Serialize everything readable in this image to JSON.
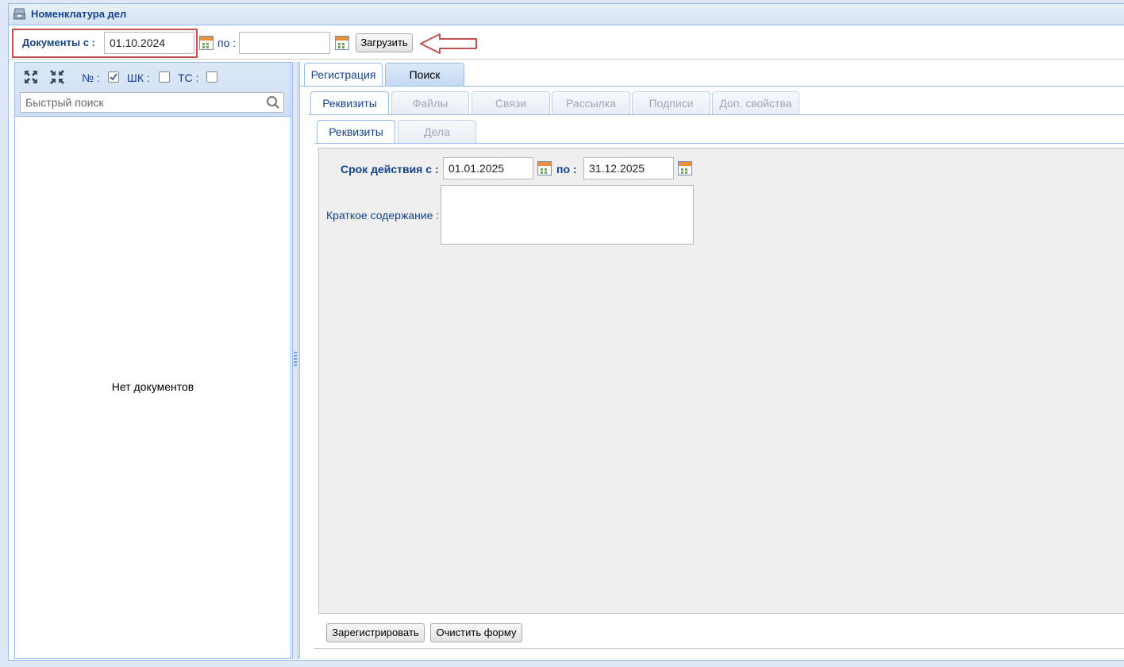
{
  "window": {
    "title": "Номенклатура дел"
  },
  "toolbar": {
    "docs_from_label": "Документы с :",
    "date_from": "01.10.2024",
    "to_label": "по :",
    "date_to": "",
    "load_button": "Загрузить"
  },
  "left_panel": {
    "number_label": "№ :",
    "number_checked": true,
    "shk_label": "ШК :",
    "shk_checked": false,
    "ts_label": "ТС :",
    "ts_checked": false,
    "search_placeholder": "Быстрый поиск",
    "empty_message": "Нет документов"
  },
  "tabs_main": [
    {
      "label": "Регистрация",
      "active": true
    },
    {
      "label": "Поиск",
      "active": false
    }
  ],
  "tabs_sub": [
    {
      "label": "Реквизиты",
      "active": true
    },
    {
      "label": "Файлы",
      "active": false
    },
    {
      "label": "Связи",
      "active": false
    },
    {
      "label": "Рассылка",
      "active": false
    },
    {
      "label": "Подписи",
      "active": false
    },
    {
      "label": "Доп. свойства",
      "active": false
    }
  ],
  "tabs_inner": [
    {
      "label": "Реквизиты",
      "active": true
    },
    {
      "label": "Дела",
      "active": false
    }
  ],
  "form": {
    "validity_label": "Срок действия с :",
    "validity_from": "01.01.2025",
    "validity_to_label": "по  :",
    "validity_to": "31.12.2025",
    "summary_label": "Краткое содержание :",
    "summary_value": ""
  },
  "buttons": {
    "register": "Зарегистрировать",
    "clear": "Очистить форму"
  },
  "colors": {
    "accent": "#15428b",
    "border": "#99bbe8",
    "highlight": "#c0504d"
  }
}
